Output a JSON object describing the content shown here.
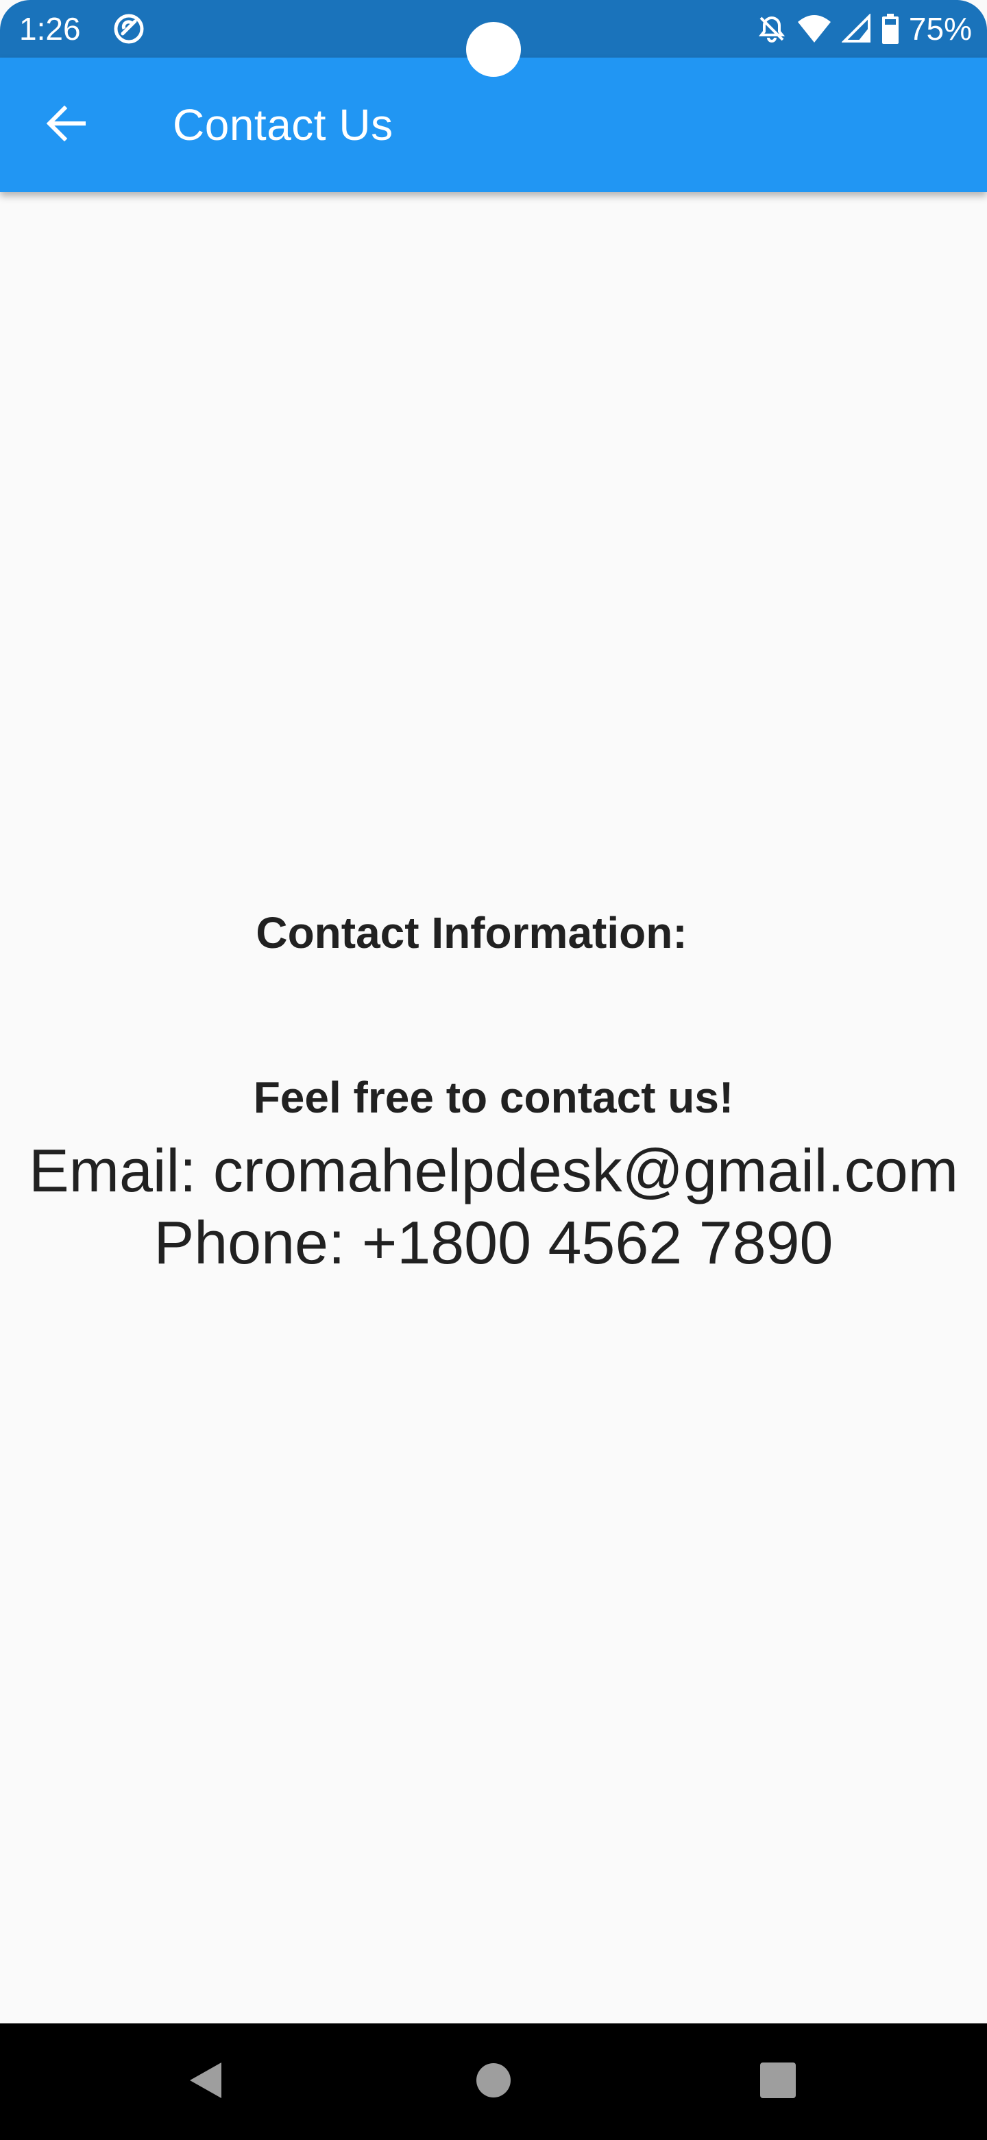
{
  "status_bar": {
    "time": "1:26",
    "battery_percent": "75%",
    "icons": [
      "app-notification-icon",
      "alarm-off-icon",
      "wifi-icon",
      "cell-signal-icon",
      "battery-icon"
    ],
    "background_color": "#1a73bb"
  },
  "app_bar": {
    "title": "Contact Us",
    "back_icon": "arrow-left-icon",
    "background_color": "#2196f3"
  },
  "content": {
    "heading": "Contact Information:",
    "subheading": "Feel free to contact us!",
    "email_line": "Email: cromahelpdesk@gmail.com",
    "phone_line": "Phone: +1800 4562 7890",
    "text_color": "#212121",
    "background_color": "#fafafa"
  },
  "nav_bar": {
    "buttons": [
      "nav-back-icon",
      "nav-home-icon",
      "nav-recents-icon"
    ],
    "icon_color": "#9e9e9e"
  }
}
